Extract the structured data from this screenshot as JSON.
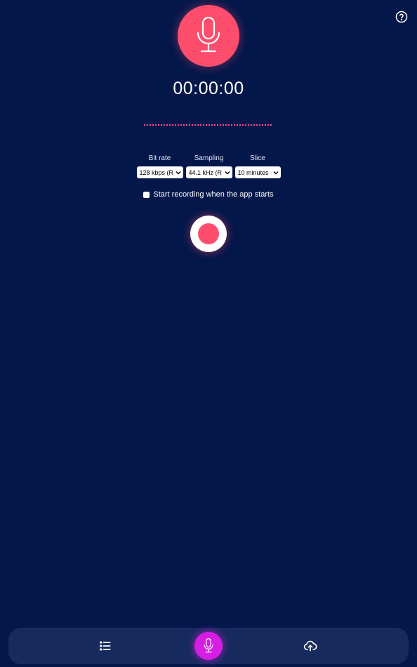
{
  "timer": {
    "value": "00:00:00"
  },
  "settings": {
    "bitrate": {
      "label": "Bit rate",
      "value": "128 kbps (R"
    },
    "sampling": {
      "label": "Sampling",
      "value": "44.1 kHz (R"
    },
    "slice": {
      "label": "Slice",
      "value": "10 minutes"
    }
  },
  "autostart": {
    "label": "Start recording when the app starts",
    "checked": false
  },
  "icons": {
    "help": "help-circle-icon",
    "hero": "microphone-icon",
    "list": "list-icon",
    "record_nav": "microphone-icon",
    "upload": "cloud-upload-icon"
  },
  "colors": {
    "background": "#04174a",
    "accent": "#ff4d6d",
    "nav_bar": "#172a5e",
    "nav_active": "#d61ee3"
  }
}
